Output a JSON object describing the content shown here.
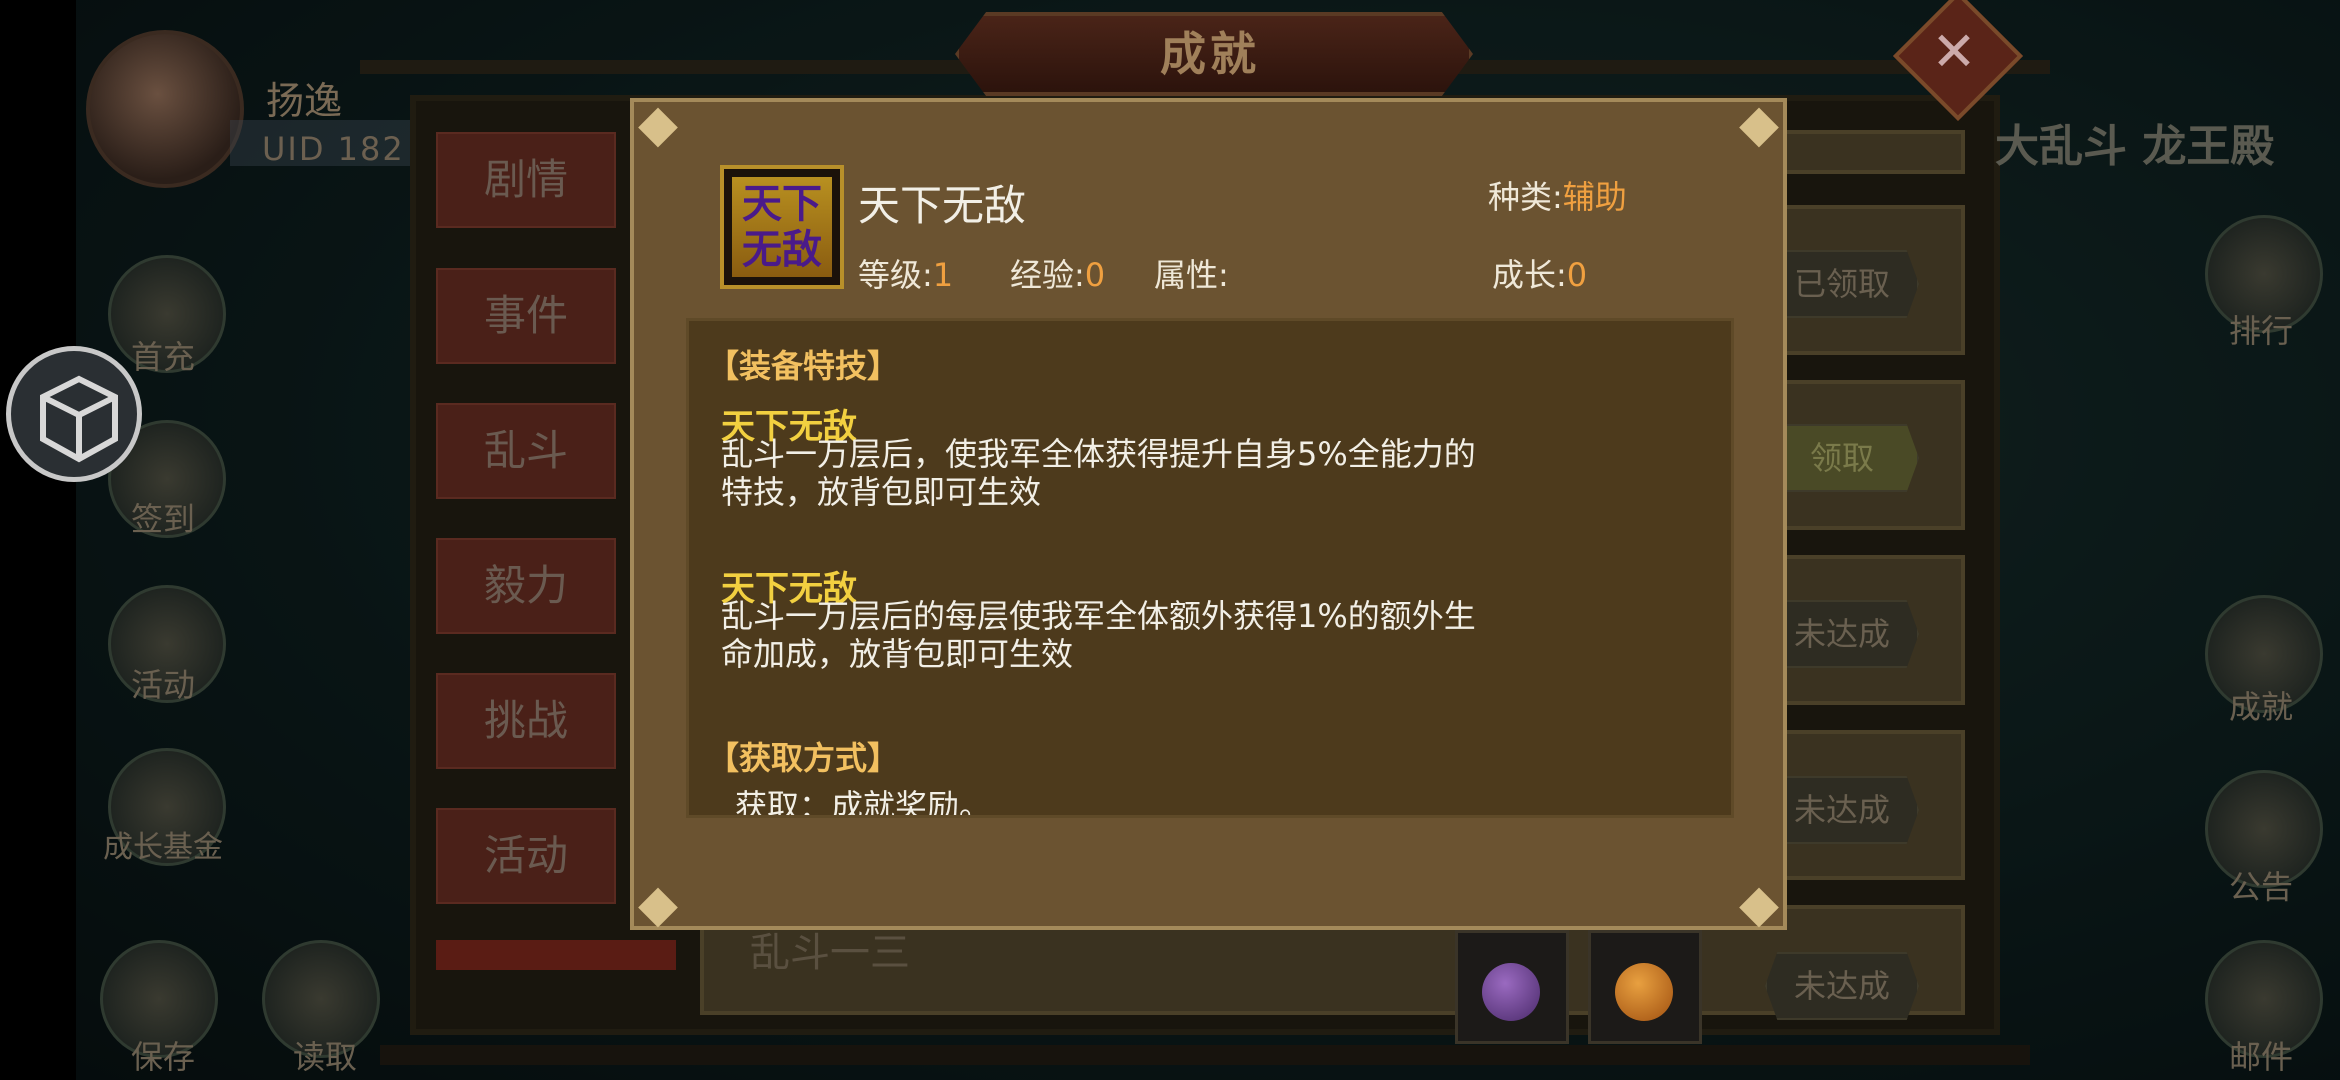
{
  "background": {
    "player": {
      "name": "扬逸",
      "uid": "UID  182"
    },
    "side_left": [
      {
        "label": "首充"
      },
      {
        "label": "签到"
      },
      {
        "label": "活动"
      },
      {
        "label": "成长基金"
      },
      {
        "label": "保存"
      },
      {
        "label": "读取"
      }
    ],
    "side_right": [
      {
        "label": "排行"
      },
      {
        "label": "成就"
      },
      {
        "label": "公告"
      },
      {
        "label": "邮件"
      }
    ],
    "right_header": "大乱斗 龙王殿",
    "panel_title": "成就",
    "close_glyph": "✕",
    "tabs": [
      "剧情",
      "事件",
      "乱斗",
      "毅力",
      "挑战",
      "活动"
    ],
    "rows": [
      {
        "status": "已领取"
      },
      {
        "status": "领取"
      },
      {
        "status": "未达成"
      },
      {
        "status": "未达成"
      },
      {
        "status": "未达成"
      }
    ],
    "last_row_title": "乱斗一三"
  },
  "popup": {
    "item_icon_text": "天下无敌",
    "item_name": "天下无敌",
    "kind_label": "种类:",
    "kind_value": "辅助",
    "level_label": "等级:",
    "level_value": "1",
    "exp_label": "经验:",
    "exp_value": "0",
    "attr_label": "属性:",
    "growth_label": "成长:",
    "growth_value": "0",
    "section_skill": "【装备特技】",
    "skills": [
      {
        "title": "天下无敌",
        "desc": "乱斗一万层后，使我军全体获得提升自身5%全能力的特技，放背包即可生效"
      },
      {
        "title": "天下无敌",
        "desc": "乱斗一万层后的每层使我军全体额外获得1%的额外生命加成，放背包即可生效"
      }
    ],
    "section_obtain": "【获取方式】",
    "obtain_text": "获取：成就奖励。"
  },
  "colors": {
    "popup_bg": "#6b5331",
    "accent_orange": "#f0a040",
    "skill_yellow": "#f2d040"
  }
}
